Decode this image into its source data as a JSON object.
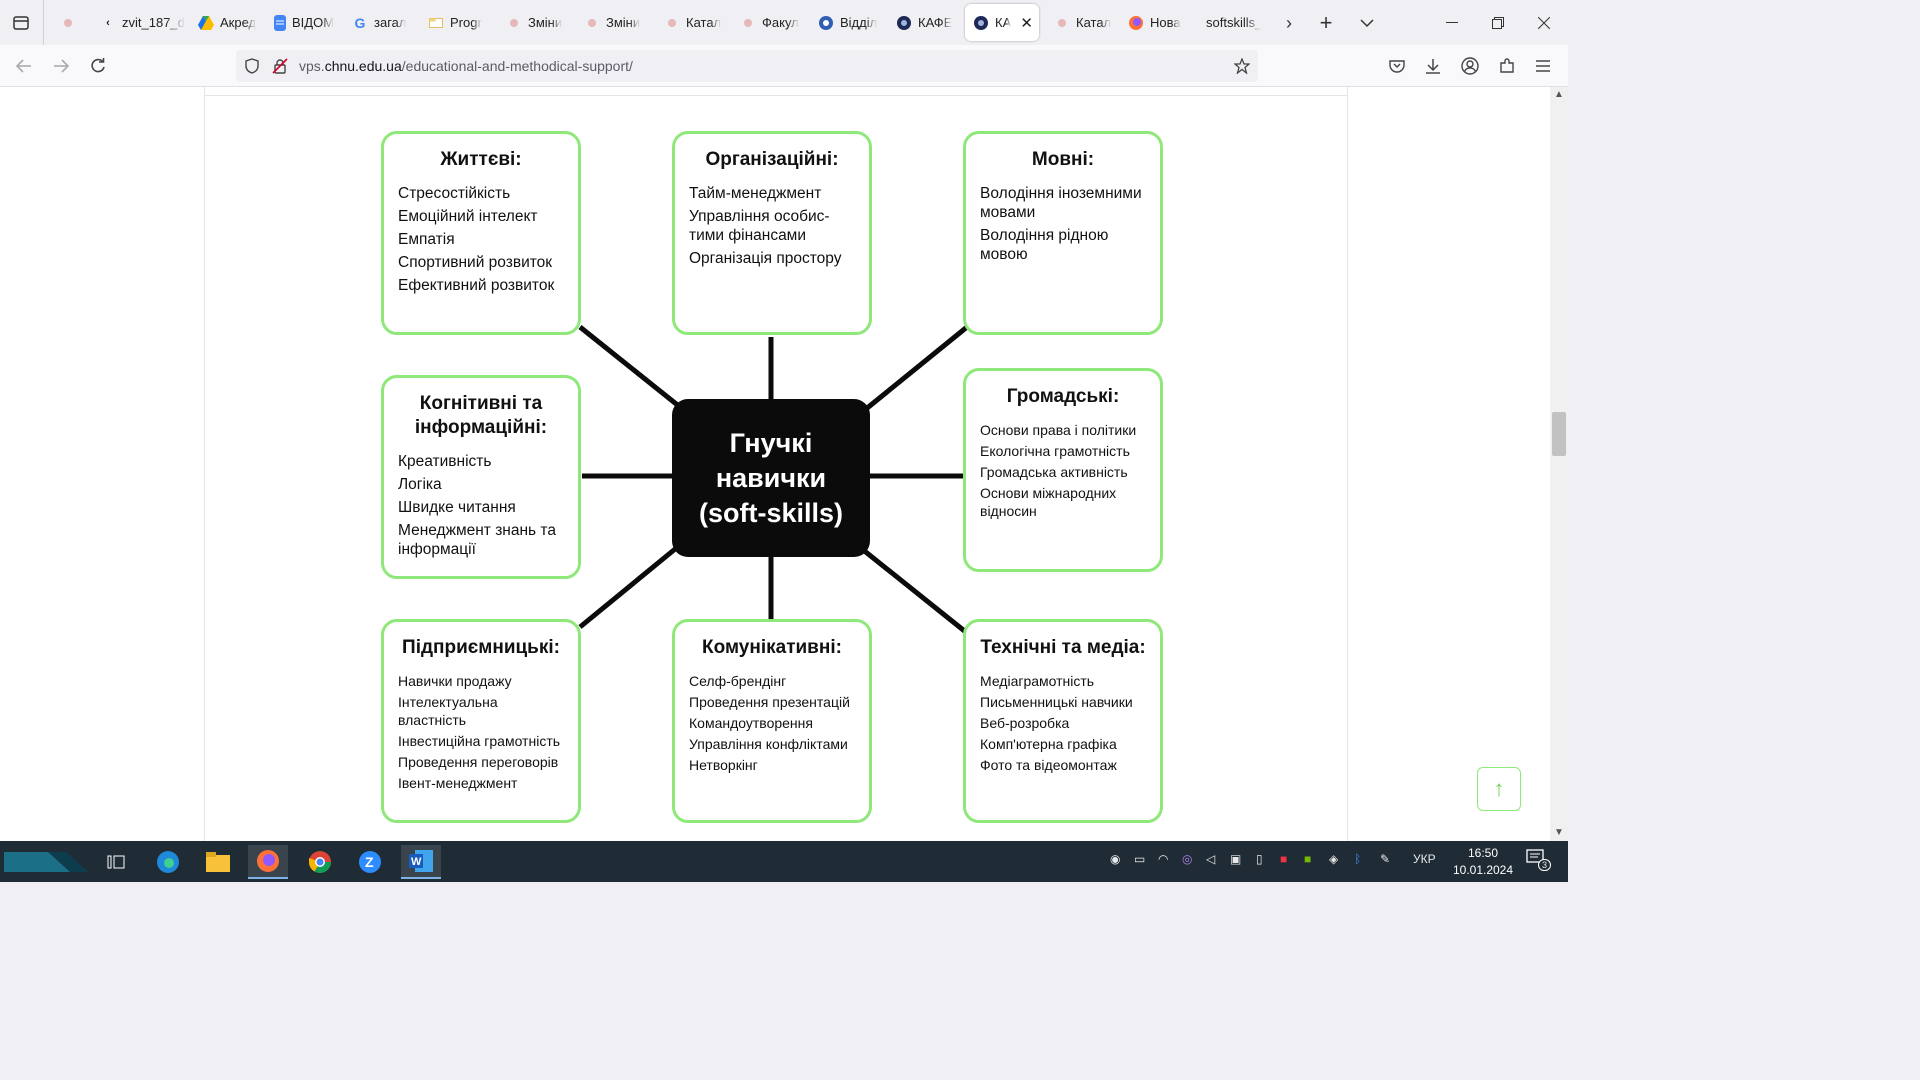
{
  "browser": {
    "tabs": [
      {
        "title": "",
        "icon": "dot-icon"
      },
      {
        "title": "zvit_187_d",
        "icon": "chevron-left-icon"
      },
      {
        "title": "Акред",
        "icon": "google-drive-icon"
      },
      {
        "title": "ВІДОМ",
        "icon": "google-docs-icon"
      },
      {
        "title": "загал",
        "icon": "google-icon"
      },
      {
        "title": "Progr",
        "icon": "folder-icon"
      },
      {
        "title": "Зміни",
        "icon": "dot-icon"
      },
      {
        "title": "Зміни",
        "icon": "dot-icon"
      },
      {
        "title": "Катал",
        "icon": "dot-icon"
      },
      {
        "title": "Факул",
        "icon": "dot-icon"
      },
      {
        "title": "Відділ",
        "icon": "university-icon"
      },
      {
        "title": "КАФЕ",
        "icon": "university-icon"
      },
      {
        "title": "КА",
        "icon": "university-icon",
        "active": true
      },
      {
        "title": "Катал",
        "icon": "dot-icon"
      },
      {
        "title": "Нова",
        "icon": "firefox-icon"
      },
      {
        "title": "softskills_",
        "icon": "none"
      }
    ],
    "url_prefix": "vps.",
    "url_domain": "chnu.edu.ua",
    "url_path": "/educational-and-methodical-support/"
  },
  "diagram": {
    "center_line1": "Гнучкі",
    "center_line2": "навички",
    "center_line3": "(soft-skills)",
    "boxes": [
      {
        "title": "Життєві:",
        "items": [
          "Стресостійкість",
          "Емоційний інтелект",
          "Емпатія",
          "Спортивний розвиток",
          "Ефективний розвиток"
        ]
      },
      {
        "title": "Організаційні:",
        "items": [
          "Тайм-менеджмент",
          "Управління особис-тими фінансами",
          "Організація простору"
        ]
      },
      {
        "title": "Мовні:",
        "items": [
          "Володіння іноземними мовами",
          "Володіння рідною мовою"
        ]
      },
      {
        "title": "Когнітивні та інформаційні:",
        "items": [
          "Креативність",
          "Логіка",
          "Швидке читання",
          "Менеджмент знань та інформації"
        ]
      },
      {
        "title": "Громадські:",
        "items": [
          "Основи права і політики",
          "Екологічна грамотність",
          "Громадська активність",
          "Основи міжнародних відносин"
        ]
      },
      {
        "title": "Підприємницькі:",
        "items": [
          "Навички продажу",
          "Інтелектуальна властність",
          "Інвестиційна грамотність",
          "Проведення переговорів",
          "Івент-менеджмент"
        ]
      },
      {
        "title": "Комунікативні:",
        "items": [
          "Селф-брендінг",
          "Проведення презентацій",
          "Командоутворення",
          "Управління конфліктами",
          "Нетворкінг"
        ]
      },
      {
        "title": "Технічні та медіа:",
        "items": [
          "Медіаграмотність",
          "Письменницькі навчики",
          "Веб-розробка",
          "Комп'ютерна графіка",
          "Фото та відеомонтаж"
        ]
      }
    ]
  },
  "taskbar": {
    "language": "УКР",
    "time": "16:50",
    "date": "10.01.2024",
    "notifications": "3"
  },
  "colors": {
    "box_border": "#8ee87a",
    "center_bg": "#0b0b0b"
  }
}
